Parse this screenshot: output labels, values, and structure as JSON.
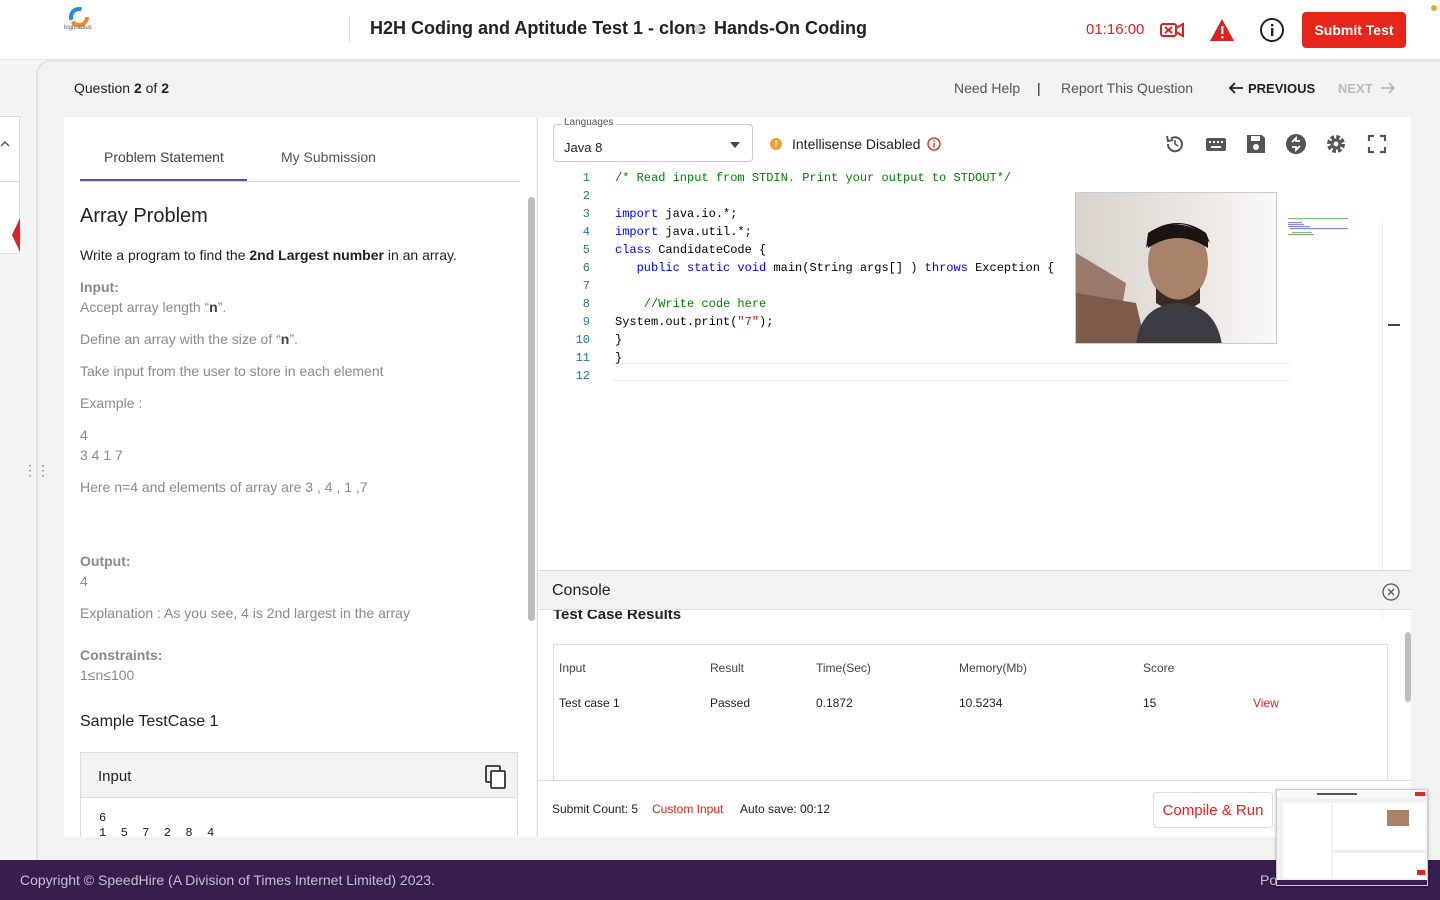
{
  "header": {
    "test_title": "H2H Coding and Aptitude Test 1 - clone",
    "section_title": "Hands-On Coding",
    "timer": "01:16:00",
    "submit_label": "Submit Test",
    "logo_text": "highradius"
  },
  "question_nav": {
    "prefix": "Question ",
    "current": "2",
    "of": " of ",
    "total": "2",
    "need_help": "Need Help",
    "separator": "|",
    "report": "Report This Question",
    "previous": "PREVIOUS",
    "next": "NEXT"
  },
  "problem": {
    "tabs": [
      "Problem Statement",
      "My Submission"
    ],
    "title": "Array Problem",
    "intro_pre": "Write a program to find the ",
    "intro_bold": "2nd Largest number",
    "intro_post": " in an array.",
    "input_label": "Input:",
    "line1_pre": "Accept array length “",
    "line1_bold": "n",
    "line1_post": "”.",
    "line2_pre": "Define an array with the size of “",
    "line2_bold": "n",
    "line2_post": "”.",
    "line3": "Take input from the user to store in each element",
    "example_label": "Example :",
    "ex_n": "4",
    "ex_arr": "3 4 1 7",
    "ex_explain": "Here n=4 and elements of array are 3 , 4 , 1 ,7",
    "output_label": "Output:",
    "output_val": "4",
    "explanation": "Explanation : As you see, 4 is 2nd largest in the array",
    "constraints_label": "Constraints:",
    "constraints_val": "1≤n≤100",
    "sample_title": "Sample TestCase 1",
    "sample_input_label": "Input",
    "sample_input_line1": "6",
    "sample_input_line2": "1  5  7  2  8  4"
  },
  "editor": {
    "language_label": "Languages",
    "language": "Java 8",
    "intellisense": "Intellisense Disabled",
    "code_lines": [
      {
        "n": "1",
        "parts": [
          {
            "t": "/* Read input from STDIN. Print your output to STDOUT*/",
            "c": "cm"
          }
        ]
      },
      {
        "n": "2",
        "parts": []
      },
      {
        "n": "3",
        "parts": [
          {
            "t": "import",
            "c": "kw"
          },
          {
            "t": " java.io.*;",
            "c": ""
          }
        ]
      },
      {
        "n": "4",
        "parts": [
          {
            "t": "import",
            "c": "kw"
          },
          {
            "t": " java.util.*;",
            "c": ""
          }
        ]
      },
      {
        "n": "5",
        "parts": [
          {
            "t": "class",
            "c": "kw"
          },
          {
            "t": " CandidateCode {",
            "c": ""
          }
        ]
      },
      {
        "n": "6",
        "parts": [
          {
            "t": "   ",
            "c": ""
          },
          {
            "t": "public static void",
            "c": "kw"
          },
          {
            "t": " main(String args[] ) ",
            "c": ""
          },
          {
            "t": "throws",
            "c": "kw"
          },
          {
            "t": " Exception {",
            "c": ""
          }
        ]
      },
      {
        "n": "7",
        "parts": []
      },
      {
        "n": "8",
        "parts": [
          {
            "t": "    //Write code here",
            "c": "cm"
          }
        ]
      },
      {
        "n": "9",
        "parts": [
          {
            "t": "System.out.print(",
            "c": ""
          },
          {
            "t": "\"7\"",
            "c": "st"
          },
          {
            "t": ");",
            "c": ""
          }
        ]
      },
      {
        "n": "10",
        "parts": [
          {
            "t": "}",
            "c": ""
          }
        ]
      },
      {
        "n": "11",
        "parts": [
          {
            "t": "}",
            "c": ""
          }
        ]
      },
      {
        "n": "12",
        "parts": []
      }
    ]
  },
  "console": {
    "title": "Console",
    "results_title": "Test Case Results",
    "columns": [
      "Input",
      "Result",
      "Time(Sec)",
      "Memory(Mb)",
      "Score"
    ],
    "rows": [
      {
        "input": "Test case 1",
        "result": "Passed",
        "time": "0.1872",
        "memory": "10.5234",
        "score": "15",
        "action": "View"
      }
    ],
    "submit_count": "Submit Count: 5",
    "custom_input": "Custom Input",
    "auto_save": "Auto save: 00:12",
    "compile_label": "Compile & Run"
  },
  "footer": {
    "copyright": "Copyright © SpeedHire (A Division of Times Internet Limited) 2023.",
    "right_text": "Po"
  },
  "colors": {
    "accent_red": "#e8251b",
    "tab_underline": "#5b4fa8",
    "footer_bg": "#3a1d4f"
  }
}
